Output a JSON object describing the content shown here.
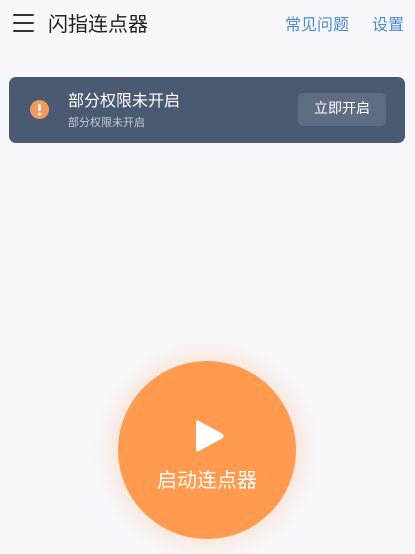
{
  "header": {
    "title": "闪指连点器",
    "faq_label": "常见问题",
    "settings_label": "设置",
    "menu_icon": "hamburger-menu-icon"
  },
  "permission_banner": {
    "title": "部分权限未开启",
    "subtitle": "部分权限未开启",
    "action_label": "立即开启",
    "icon": "warning-icon",
    "accent_color": "#f39a5b",
    "background_color": "#4a5a72"
  },
  "main": {
    "start_label": "启动连点器",
    "start_icon": "play-icon",
    "start_color": "#ff9a4f"
  }
}
